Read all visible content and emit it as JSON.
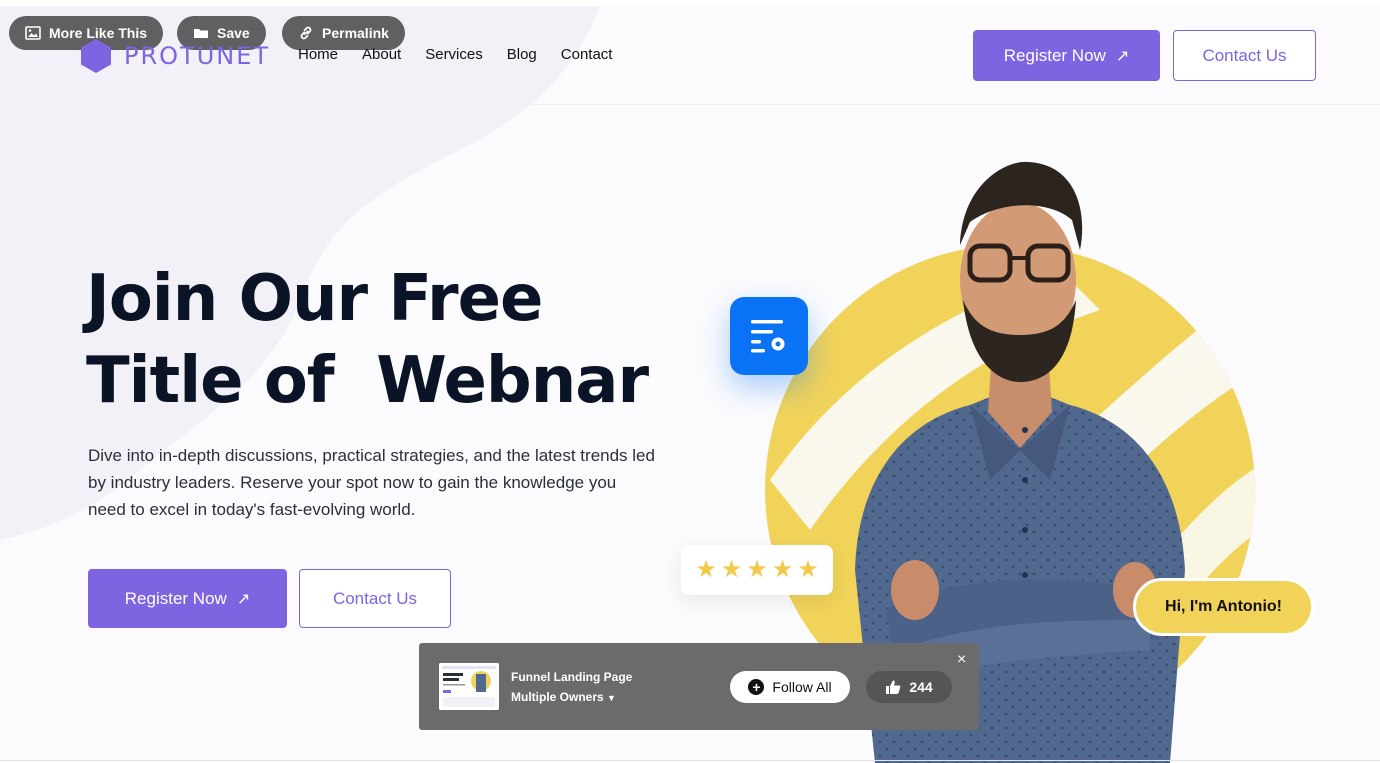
{
  "toolbar": {
    "more_like_this": "More Like This",
    "save": "Save",
    "permalink": "Permalink"
  },
  "header": {
    "logo_text": "PROTUNET",
    "nav": [
      "Home",
      "About",
      "Services",
      "Blog",
      "Contact"
    ],
    "register_label": "Register Now",
    "contact_label": "Contact Us"
  },
  "hero": {
    "title_line1": "Join Our Free",
    "title_line2": "Title of  Webnar",
    "description": "Dive into in-depth discussions, practical strategies, and the latest trends led by industry leaders. Reserve your spot now to gain the knowledge you need to excel in today's fast-evolving world.",
    "register_label": "Register Now",
    "contact_label": "Contact Us",
    "arrow": "↗"
  },
  "illustration": {
    "rating_stars": 5,
    "star_glyph": "★",
    "speech_bubble": "Hi, I'm Antonio!"
  },
  "overlay": {
    "title": "Funnel Landing Page",
    "owner": "Multiple Owners",
    "follow_label": "Follow All",
    "like_count": "244",
    "close": "×"
  },
  "colors": {
    "accent": "#7e64e0",
    "heading": "#0b1326",
    "yellow": "#f1d35a",
    "tool_blue": "#0a72f5",
    "star": "#f3c94a"
  }
}
